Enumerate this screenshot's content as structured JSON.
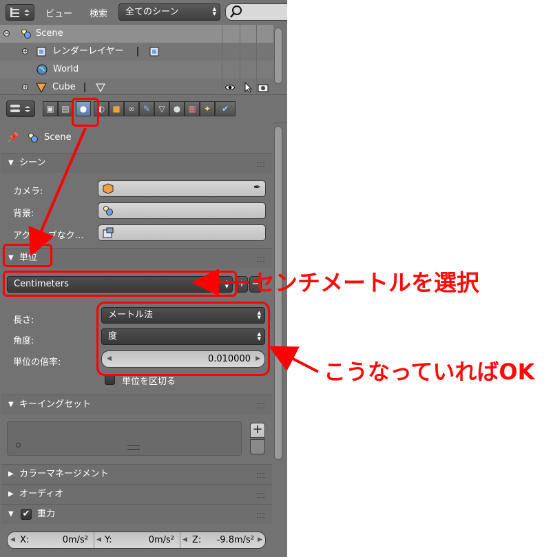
{
  "header": {
    "menu_view": "ビュー",
    "menu_search": "検索",
    "scene_select": "全てのシーン"
  },
  "outliner": {
    "rows": [
      {
        "label": "Scene",
        "expand": "−"
      },
      {
        "label": "レンダーレイヤー",
        "expand": "+"
      },
      {
        "label": "World"
      },
      {
        "label": "Cube",
        "expand": "+"
      }
    ]
  },
  "context": {
    "label": "Scene"
  },
  "scene_panel": {
    "title": "シーン",
    "camera_label": "カメラ:",
    "background_label": "背景:",
    "active_clip_label": "アクティブなク…"
  },
  "units_panel": {
    "title": "単位",
    "preset": "Centimeters",
    "length_label": "長さ:",
    "length_value": "メートル法",
    "angle_label": "角度:",
    "angle_value": "度",
    "scale_label": "単位の倍率:",
    "scale_value": "0.010000",
    "separate_label": "単位を区切る"
  },
  "keying_panel": {
    "title": "キーイングセット",
    "add": "+",
    "remove": "−"
  },
  "collapsed_panels": [
    "カラーマネージメント",
    "オーディオ"
  ],
  "gravity_panel": {
    "title": "重力",
    "x_label": "X:",
    "x_value": "0m/s²",
    "y_label": "Y:",
    "y_value": "0m/s²",
    "z_label": "Z:",
    "z_value": "-9.8m/s²"
  },
  "annotations": {
    "select_cm": "センチメートルを選択",
    "ok": "こうなっていればOK"
  },
  "colors": {
    "annotation": "#ff0000",
    "panel_bg": "#727272",
    "active_tab": "#6f8bbd"
  }
}
